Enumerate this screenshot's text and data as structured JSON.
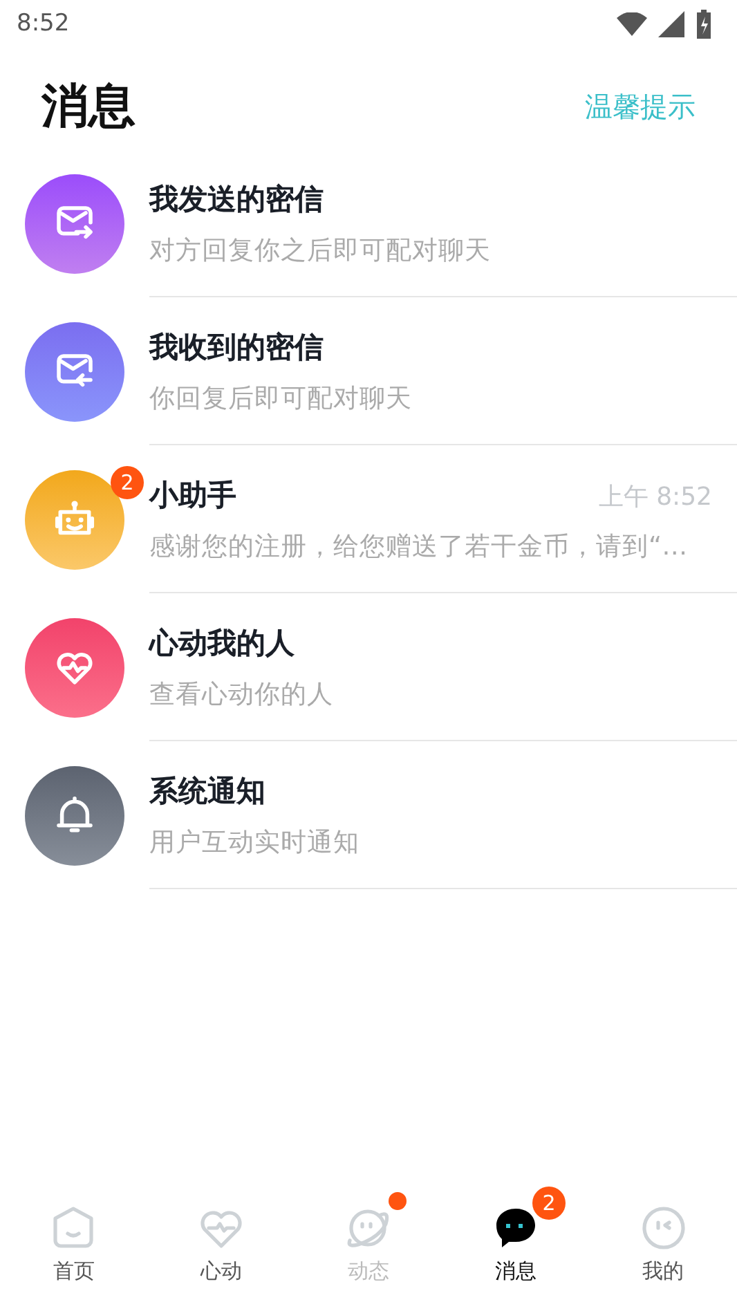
{
  "status_bar": {
    "time": "8:52"
  },
  "header": {
    "title": "消息",
    "action": "温馨提示"
  },
  "conversations": [
    {
      "kind": "send",
      "title": "我发送的密信",
      "preview": "对方回复你之后即可配对聊天"
    },
    {
      "kind": "receive",
      "title": "我收到的密信",
      "preview": "你回复后即可配对聊天"
    },
    {
      "kind": "robot",
      "title": "小助手",
      "preview": "感谢您的注册，给您赠送了若干金币，请到“…",
      "time": "上午 8:52",
      "badge": "2"
    },
    {
      "kind": "heart",
      "title": "心动我的人",
      "preview": "查看心动你的人"
    },
    {
      "kind": "bell",
      "title": "系统通知",
      "preview": "用户互动实时通知"
    }
  ],
  "tabs": [
    {
      "kind": "home",
      "label": "首页",
      "selected": false,
      "muted": false,
      "dot": false
    },
    {
      "kind": "heart",
      "label": "心动",
      "selected": false,
      "muted": false,
      "dot": false
    },
    {
      "kind": "planet",
      "label": "动态",
      "selected": false,
      "muted": true,
      "dot": true
    },
    {
      "kind": "chat",
      "label": "消息",
      "selected": true,
      "muted": false,
      "dot": false,
      "badge": "2"
    },
    {
      "kind": "face",
      "label": "我的",
      "selected": false,
      "muted": false,
      "dot": false
    }
  ]
}
